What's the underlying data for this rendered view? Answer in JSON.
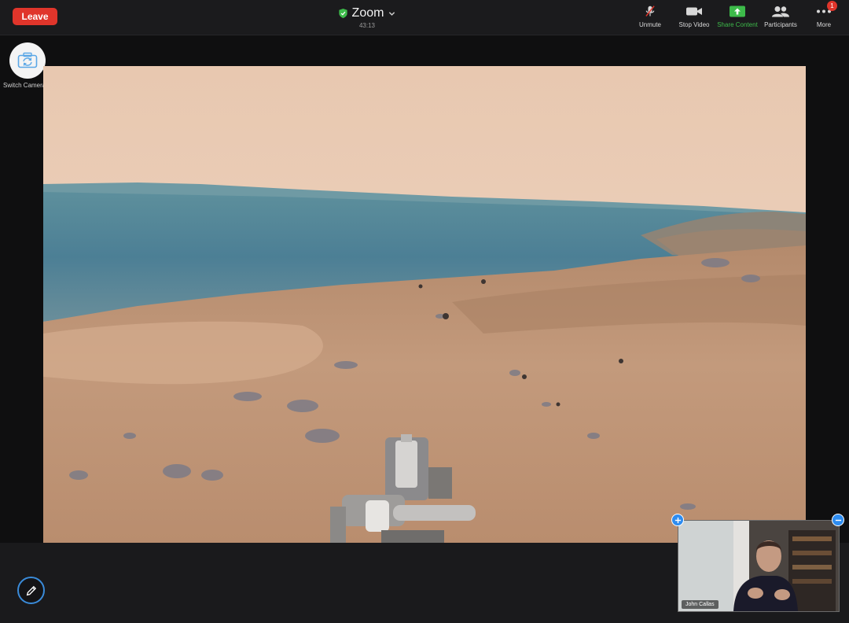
{
  "toolbar": {
    "leave_label": "Leave",
    "meeting_title": "Zoom",
    "timer": "43:13",
    "items": [
      {
        "id": "unmute",
        "label": "Unmute",
        "icon": "mic-muted-icon"
      },
      {
        "id": "stop-video",
        "label": "Stop Video",
        "icon": "video-camera-icon"
      },
      {
        "id": "share-content",
        "label": "Share Content",
        "icon": "share-screen-icon"
      },
      {
        "id": "participants",
        "label": "Participants",
        "icon": "participants-icon"
      },
      {
        "id": "more",
        "label": "More",
        "icon": "more-dots-icon",
        "badge": "1"
      }
    ]
  },
  "switch_camera": {
    "label": "Switch Camera",
    "icon": "switch-camera-icon"
  },
  "shared_content": {
    "icon": "mars-panorama-image"
  },
  "annotate": {
    "icon": "pencil-icon"
  },
  "self_view": {
    "name": "John Callas"
  },
  "colors": {
    "leave": "#e0352b",
    "share_green": "#3dbb4a",
    "accent_blue": "#2d8cf0",
    "secure_green": "#3dbb4a"
  }
}
